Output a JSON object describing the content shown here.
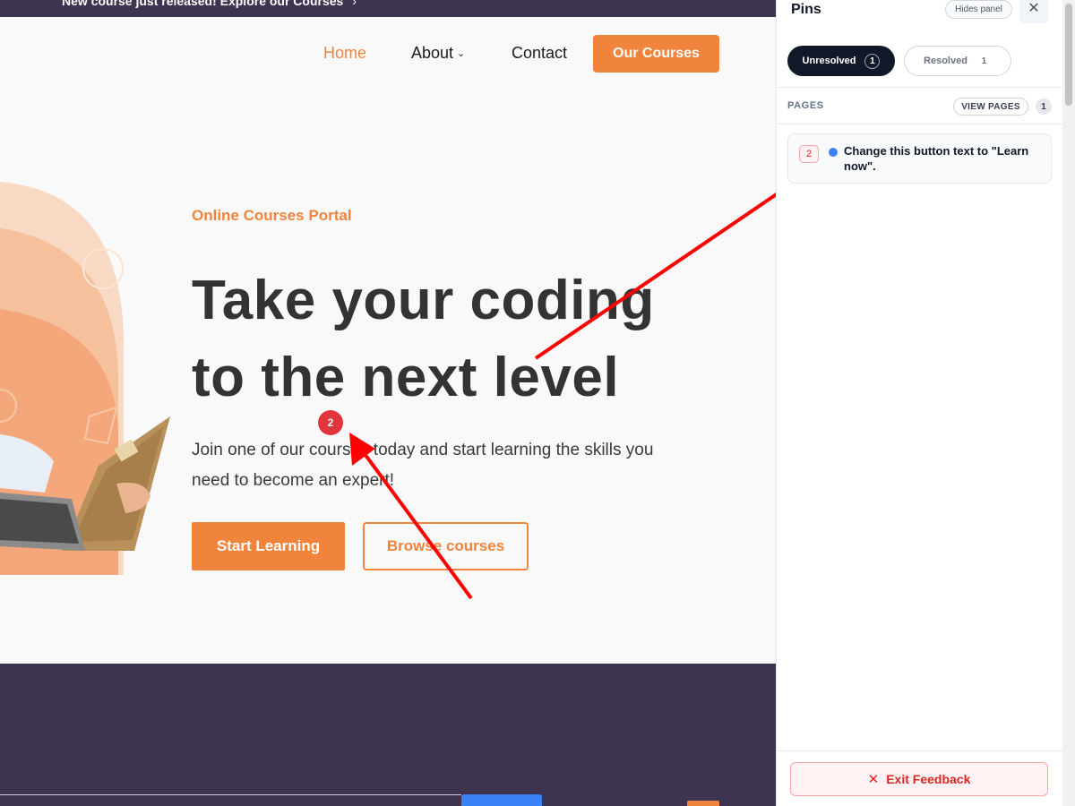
{
  "site": {
    "announcement": "New course just released! Explore our Courses",
    "announcement_arrow": "›",
    "nav": {
      "home": "Home",
      "about": "About",
      "about_chevron": "⌄",
      "contact": "Contact",
      "cta": "Our Courses"
    },
    "hero": {
      "eyebrow": "Online Courses Portal",
      "headline": "Take your coding to the next level",
      "lead": "Join one of our courses today and start learning the skills you need to become an expert!",
      "primary_button": "Start Learning",
      "secondary_button": "Browse courses"
    },
    "pin_marker": "2"
  },
  "panel": {
    "title": "Pins",
    "hide_button": "Hides panel",
    "close_icon": "✕",
    "tabs": [
      {
        "label": "Unresolved",
        "count": "1",
        "active": true
      },
      {
        "label": "Resolved",
        "count": "1",
        "active": false
      }
    ],
    "pages_label": "PAGES",
    "view_pages": "VIEW PAGES",
    "pages_count": "1",
    "pins": [
      {
        "number": "2",
        "status_color": "#3b82f6",
        "text": "Change this button text to \"Learn now\"."
      }
    ],
    "exit_icon": "✕",
    "exit_button": "Exit Feedback"
  },
  "colors": {
    "brand_orange": "#f0843c",
    "dark_purple": "#3e3350",
    "pin_red": "#e0353a",
    "arrow_red": "#ff0000"
  }
}
